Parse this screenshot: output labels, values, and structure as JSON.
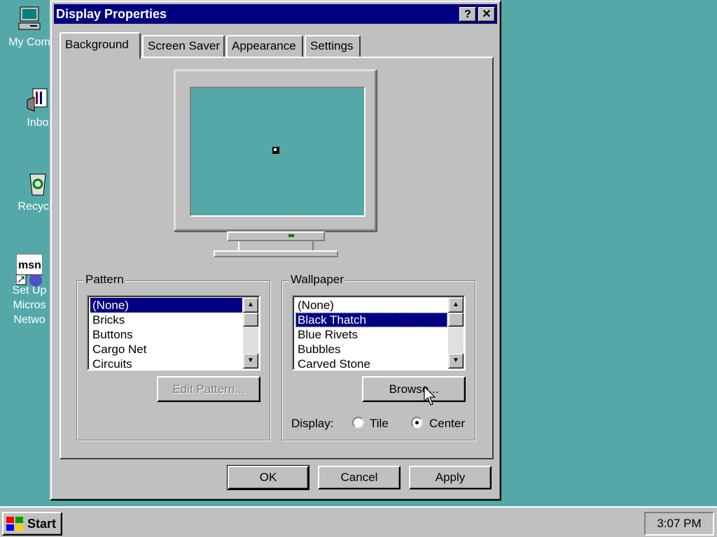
{
  "desktop": {
    "icons": [
      {
        "label": "My Com",
        "icon": "my-computer-icon"
      },
      {
        "label": "Inbo",
        "icon": "inbox-icon"
      },
      {
        "label": "Recycle",
        "icon": "recycle-bin-icon"
      },
      {
        "label": "Set Up\nMicros\nNetwo",
        "icon": "msn-setup-icon"
      }
    ]
  },
  "dialog": {
    "title": "Display Properties",
    "help_glyph": "?",
    "close_glyph": "✕",
    "tabs": [
      {
        "label": "Background"
      },
      {
        "label": "Screen Saver"
      },
      {
        "label": "Appearance"
      },
      {
        "label": "Settings"
      }
    ],
    "pattern": {
      "group_label": "Pattern",
      "items": [
        "(None)",
        "Bricks",
        "Buttons",
        "Cargo Net",
        "Circuits"
      ],
      "selected": "(None)",
      "edit_button": "Edit Pattern..."
    },
    "wallpaper": {
      "group_label": "Wallpaper",
      "items": [
        "(None)",
        "Black Thatch",
        "Blue Rivets",
        "Bubbles",
        "Carved Stone"
      ],
      "selected": "Black Thatch",
      "browse_button": "Browse...",
      "display_label": "Display:",
      "options": [
        {
          "label": "Tile",
          "checked": false
        },
        {
          "label": "Center",
          "checked": true
        }
      ]
    },
    "buttons": {
      "ok": "OK",
      "cancel": "Cancel",
      "apply": "Apply"
    }
  },
  "taskbar": {
    "start_label": "Start",
    "clock": "3:07 PM"
  },
  "colors": {
    "desktop": "#55a8a8",
    "title_bar": "#000080",
    "selection": "#000080",
    "face": "#c0c0c0"
  }
}
